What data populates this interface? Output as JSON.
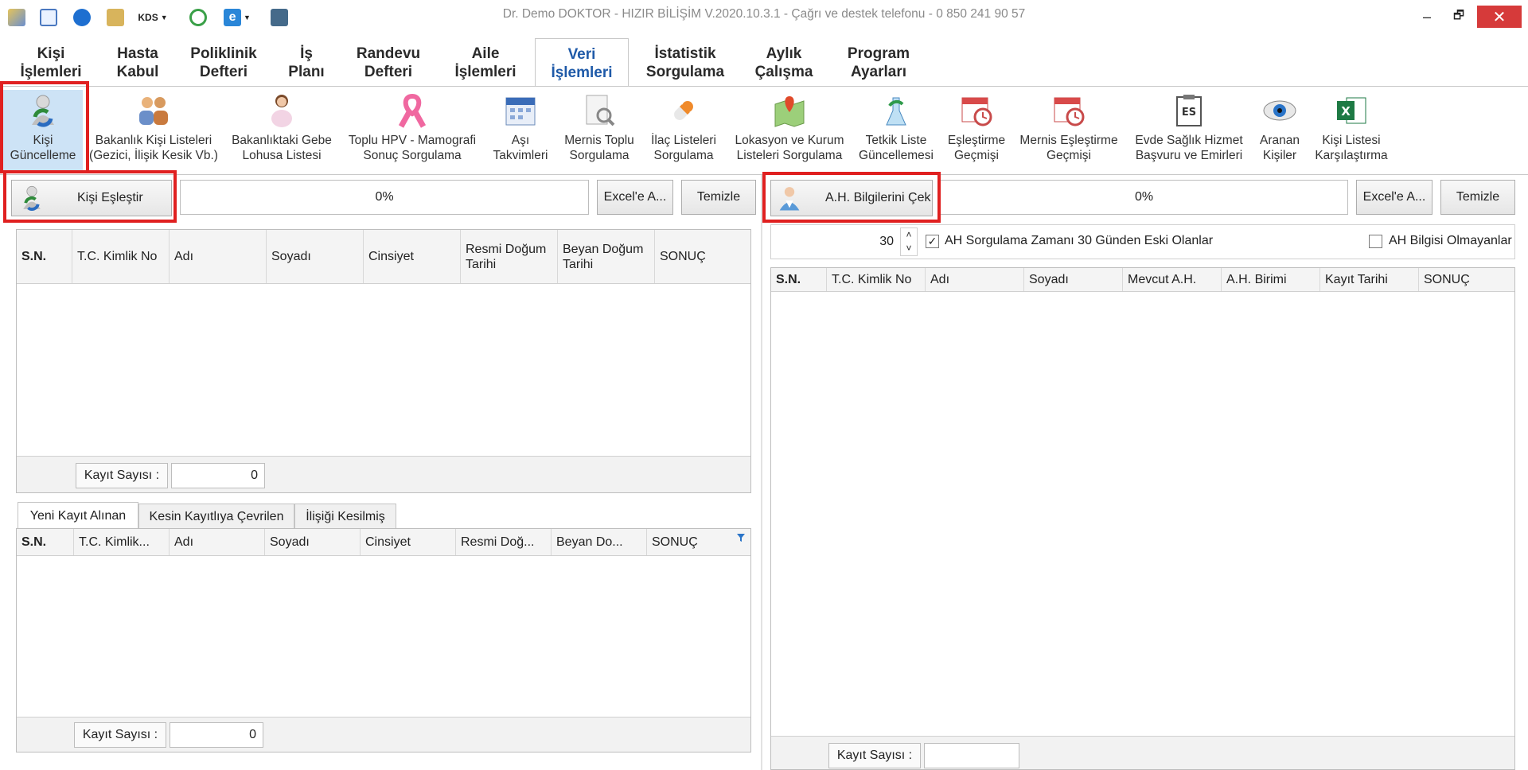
{
  "window": {
    "title": "Dr. Demo DOKTOR - HIZIR BİLİŞİM V.2020.10.3.1 - Çağrı ve destek telefonu - 0 850 241 90 57",
    "minimize": "–",
    "restore": "🗗",
    "close": "✕",
    "quick_access": [
      "kds-label"
    ],
    "kds_label": "KDS"
  },
  "menu": {
    "tabs": [
      {
        "label": "Kişi İşlemleri"
      },
      {
        "label": "Hasta Kabul"
      },
      {
        "label": "Poliklinik Defteri"
      },
      {
        "label": "İş Planı"
      },
      {
        "label": "Randevu Defteri"
      },
      {
        "label": "Aile İşlemleri"
      },
      {
        "label": "Veri İşlemleri"
      },
      {
        "label": "İstatistik Sorgulama"
      },
      {
        "label": "Aylık Çalışma"
      },
      {
        "label": "Program Ayarları"
      }
    ],
    "active_tab": "Veri İşlemleri"
  },
  "ribbon": {
    "items": [
      {
        "label": "Kişi Güncelleme",
        "icon": "person-refresh-icon"
      },
      {
        "label": "Bakanlık Kişi Listeleri (Gezici, İlişik Kesik Vb.)",
        "icon": "people-icon"
      },
      {
        "label": "Bakanlıktaki Gebe Lohusa Listesi",
        "icon": "pregnant-woman-icon"
      },
      {
        "label": "Toplu HPV - Mamografi Sonuç Sorgulama",
        "icon": "pink-ribbon-icon"
      },
      {
        "label": "Aşı Takvimleri",
        "icon": "calendar-icon"
      },
      {
        "label": "Mernis Toplu Sorgulama",
        "icon": "document-search-icon"
      },
      {
        "label": "İlaç Listeleri Sorgulama",
        "icon": "pill-icon"
      },
      {
        "label": "Lokasyon ve Kurum Listeleri Sorgulama",
        "icon": "map-pin-icon"
      },
      {
        "label": "Tetkik Liste Güncellemesi",
        "icon": "lab-refresh-icon"
      },
      {
        "label": "Eşleştirme Geçmişi",
        "icon": "calendar-clock-icon"
      },
      {
        "label": "Mernis Eşleştirme Geçmişi",
        "icon": "calendar-clock-icon"
      },
      {
        "label": "Evde Sağlık Hizmet Başvuru ve Emirleri",
        "icon": "clipboard-es-icon"
      },
      {
        "label": "Aranan Kişiler",
        "icon": "eye-icon"
      },
      {
        "label": "Kişi Listesi Karşılaştırma",
        "icon": "excel-icon"
      }
    ],
    "es_badge": "ES",
    "excel_badge": "X"
  },
  "left": {
    "match_button": "Kişi Eşleştir",
    "progress": "0%",
    "excel_button": "Excel'e A...",
    "clear_button": "Temizle",
    "columns": [
      {
        "label": "S.N."
      },
      {
        "label": "T.C. Kimlik No"
      },
      {
        "label": "Adı"
      },
      {
        "label": "Soyadı"
      },
      {
        "label": "Cinsiyet"
      },
      {
        "label": "Resmi Doğum Tarihi"
      },
      {
        "label": "Beyan Doğum Tarihi"
      },
      {
        "label": "SONUÇ"
      }
    ],
    "record_label": "Kayıt Sayısı :",
    "record_count": "0",
    "subtabs": [
      "Yeni Kayıt Alınan",
      "Kesin Kayıtlıya Çevrilen",
      "İlişiği Kesilmiş"
    ],
    "sub_columns": [
      {
        "label": "S.N."
      },
      {
        "label": "T.C. Kimlik..."
      },
      {
        "label": "Adı"
      },
      {
        "label": "Soyadı"
      },
      {
        "label": "Cinsiyet"
      },
      {
        "label": "Resmi Doğ..."
      },
      {
        "label": "Beyan Do..."
      },
      {
        "label": "SONUÇ"
      }
    ],
    "sub_record_label": "Kayıt Sayısı :",
    "sub_record_count": "0"
  },
  "right": {
    "fetch_button": "A.H. Bilgilerini Çek",
    "progress": "0%",
    "excel_button": "Excel'e A...",
    "clear_button": "Temizle",
    "days_value": "30",
    "spin_up": "˄",
    "spin_down": "˅",
    "check_older": "AH Sorgulama Zamanı 30 Günden Eski Olanlar",
    "check_older_mark": "✓",
    "check_no_info": "AH Bilgisi Olmayanlar",
    "columns": [
      {
        "label": "S.N."
      },
      {
        "label": "T.C. Kimlik No"
      },
      {
        "label": "Adı"
      },
      {
        "label": "Soyadı"
      },
      {
        "label": "Mevcut A.H."
      },
      {
        "label": "A.H. Birimi"
      },
      {
        "label": "Kayıt Tarihi"
      },
      {
        "label": "SONUÇ"
      }
    ],
    "record_label": "Kayıt Sayısı :",
    "record_count": ""
  }
}
